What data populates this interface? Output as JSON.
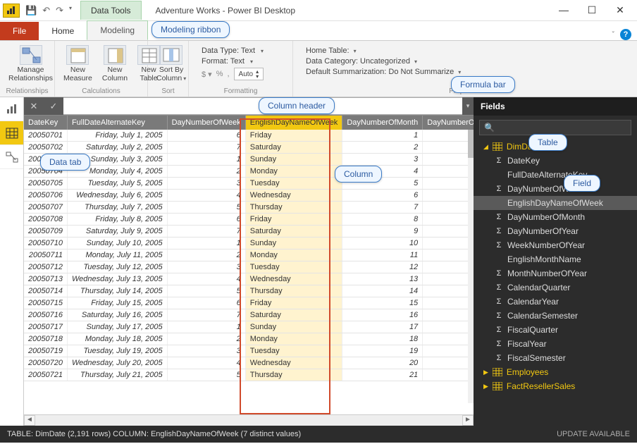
{
  "window": {
    "title": "Adventure Works - Power BI Desktop",
    "data_tools": "Data Tools"
  },
  "tabs": {
    "file": "File",
    "home": "Home",
    "modeling": "Modeling"
  },
  "ribbon": {
    "relationships_group": "Relationships",
    "manage_rel": "Manage\nRelationships",
    "calculations_group": "Calculations",
    "new_measure": "New\nMeasure",
    "new_column": "New\nColumn",
    "new_table": "New\nTable",
    "sort_group": "Sort",
    "sort_by": "Sort By\nColumn",
    "formatting_group": "Formatting",
    "fmt_datatype": "Data Type: Text",
    "fmt_format": "Format: Text",
    "fmt_auto": "Auto",
    "properties_group": "Properties",
    "home_table": "Home Table:",
    "data_category": "Data Category: Uncategorized",
    "default_summ": "Default Summarization: Do Not Summarize"
  },
  "callouts": {
    "modeling_ribbon": "Modeling ribbon",
    "formula_bar": "Formula bar",
    "column_header": "Column header",
    "data_tab": "Data tab",
    "column": "Column",
    "table": "Table",
    "field": "Field"
  },
  "grid": {
    "columns": [
      "DateKey",
      "FullDateAlternateKey",
      "DayNumberOfWeek",
      "EnglishDayNameOfWeek",
      "DayNumberOfMonth",
      "DayNumberOfYear"
    ],
    "rows": [
      {
        "k": "20050701",
        "d": "Friday, July 1, 2005",
        "dw": "6",
        "dn": "Friday",
        "dm": "1"
      },
      {
        "k": "20050702",
        "d": "Saturday, July 2, 2005",
        "dw": "7",
        "dn": "Saturday",
        "dm": "2"
      },
      {
        "k": "20050703",
        "d": "Sunday, July 3, 2005",
        "dw": "1",
        "dn": "Sunday",
        "dm": "3"
      },
      {
        "k": "20050704",
        "d": "Monday, July 4, 2005",
        "dw": "2",
        "dn": "Monday",
        "dm": "4"
      },
      {
        "k": "20050705",
        "d": "Tuesday, July 5, 2005",
        "dw": "3",
        "dn": "Tuesday",
        "dm": "5"
      },
      {
        "k": "20050706",
        "d": "Wednesday, July 6, 2005",
        "dw": "4",
        "dn": "Wednesday",
        "dm": "6"
      },
      {
        "k": "20050707",
        "d": "Thursday, July 7, 2005",
        "dw": "5",
        "dn": "Thursday",
        "dm": "7"
      },
      {
        "k": "20050708",
        "d": "Friday, July 8, 2005",
        "dw": "6",
        "dn": "Friday",
        "dm": "8"
      },
      {
        "k": "20050709",
        "d": "Saturday, July 9, 2005",
        "dw": "7",
        "dn": "Saturday",
        "dm": "9"
      },
      {
        "k": "20050710",
        "d": "Sunday, July 10, 2005",
        "dw": "1",
        "dn": "Sunday",
        "dm": "10"
      },
      {
        "k": "20050711",
        "d": "Monday, July 11, 2005",
        "dw": "2",
        "dn": "Monday",
        "dm": "11"
      },
      {
        "k": "20050712",
        "d": "Tuesday, July 12, 2005",
        "dw": "3",
        "dn": "Tuesday",
        "dm": "12"
      },
      {
        "k": "20050713",
        "d": "Wednesday, July 13, 2005",
        "dw": "4",
        "dn": "Wednesday",
        "dm": "13"
      },
      {
        "k": "20050714",
        "d": "Thursday, July 14, 2005",
        "dw": "5",
        "dn": "Thursday",
        "dm": "14"
      },
      {
        "k": "20050715",
        "d": "Friday, July 15, 2005",
        "dw": "6",
        "dn": "Friday",
        "dm": "15"
      },
      {
        "k": "20050716",
        "d": "Saturday, July 16, 2005",
        "dw": "7",
        "dn": "Saturday",
        "dm": "16"
      },
      {
        "k": "20050717",
        "d": "Sunday, July 17, 2005",
        "dw": "1",
        "dn": "Sunday",
        "dm": "17"
      },
      {
        "k": "20050718",
        "d": "Monday, July 18, 2005",
        "dw": "2",
        "dn": "Monday",
        "dm": "18"
      },
      {
        "k": "20050719",
        "d": "Tuesday, July 19, 2005",
        "dw": "3",
        "dn": "Tuesday",
        "dm": "19"
      },
      {
        "k": "20050720",
        "d": "Wednesday, July 20, 2005",
        "dw": "4",
        "dn": "Wednesday",
        "dm": "20"
      },
      {
        "k": "20050721",
        "d": "Thursday, July 21, 2005",
        "dw": "5",
        "dn": "Thursday",
        "dm": "21"
      }
    ]
  },
  "fields": {
    "title": "Fields",
    "search_placeholder": "",
    "tables": [
      {
        "name": "DimDate",
        "expanded": true,
        "fields": [
          {
            "n": "DateKey",
            "sigma": true
          },
          {
            "n": "FullDateAlternateKey",
            "sigma": false
          },
          {
            "n": "DayNumberOfWeek",
            "sigma": true
          },
          {
            "n": "EnglishDayNameOfWeek",
            "sigma": false,
            "selected": true
          },
          {
            "n": "DayNumberOfMonth",
            "sigma": true
          },
          {
            "n": "DayNumberOfYear",
            "sigma": true
          },
          {
            "n": "WeekNumberOfYear",
            "sigma": true
          },
          {
            "n": "EnglishMonthName",
            "sigma": false
          },
          {
            "n": "MonthNumberOfYear",
            "sigma": true
          },
          {
            "n": "CalendarQuarter",
            "sigma": true
          },
          {
            "n": "CalendarYear",
            "sigma": true
          },
          {
            "n": "CalendarSemester",
            "sigma": true
          },
          {
            "n": "FiscalQuarter",
            "sigma": true
          },
          {
            "n": "FiscalYear",
            "sigma": true
          },
          {
            "n": "FiscalSemester",
            "sigma": true
          }
        ]
      },
      {
        "name": "Employees",
        "expanded": false
      },
      {
        "name": "FactResellerSales",
        "expanded": false
      }
    ]
  },
  "status": {
    "left": "TABLE: DimDate (2,191 rows) COLUMN: EnglishDayNameOfWeek (7 distinct values)",
    "right": "UPDATE AVAILABLE"
  }
}
